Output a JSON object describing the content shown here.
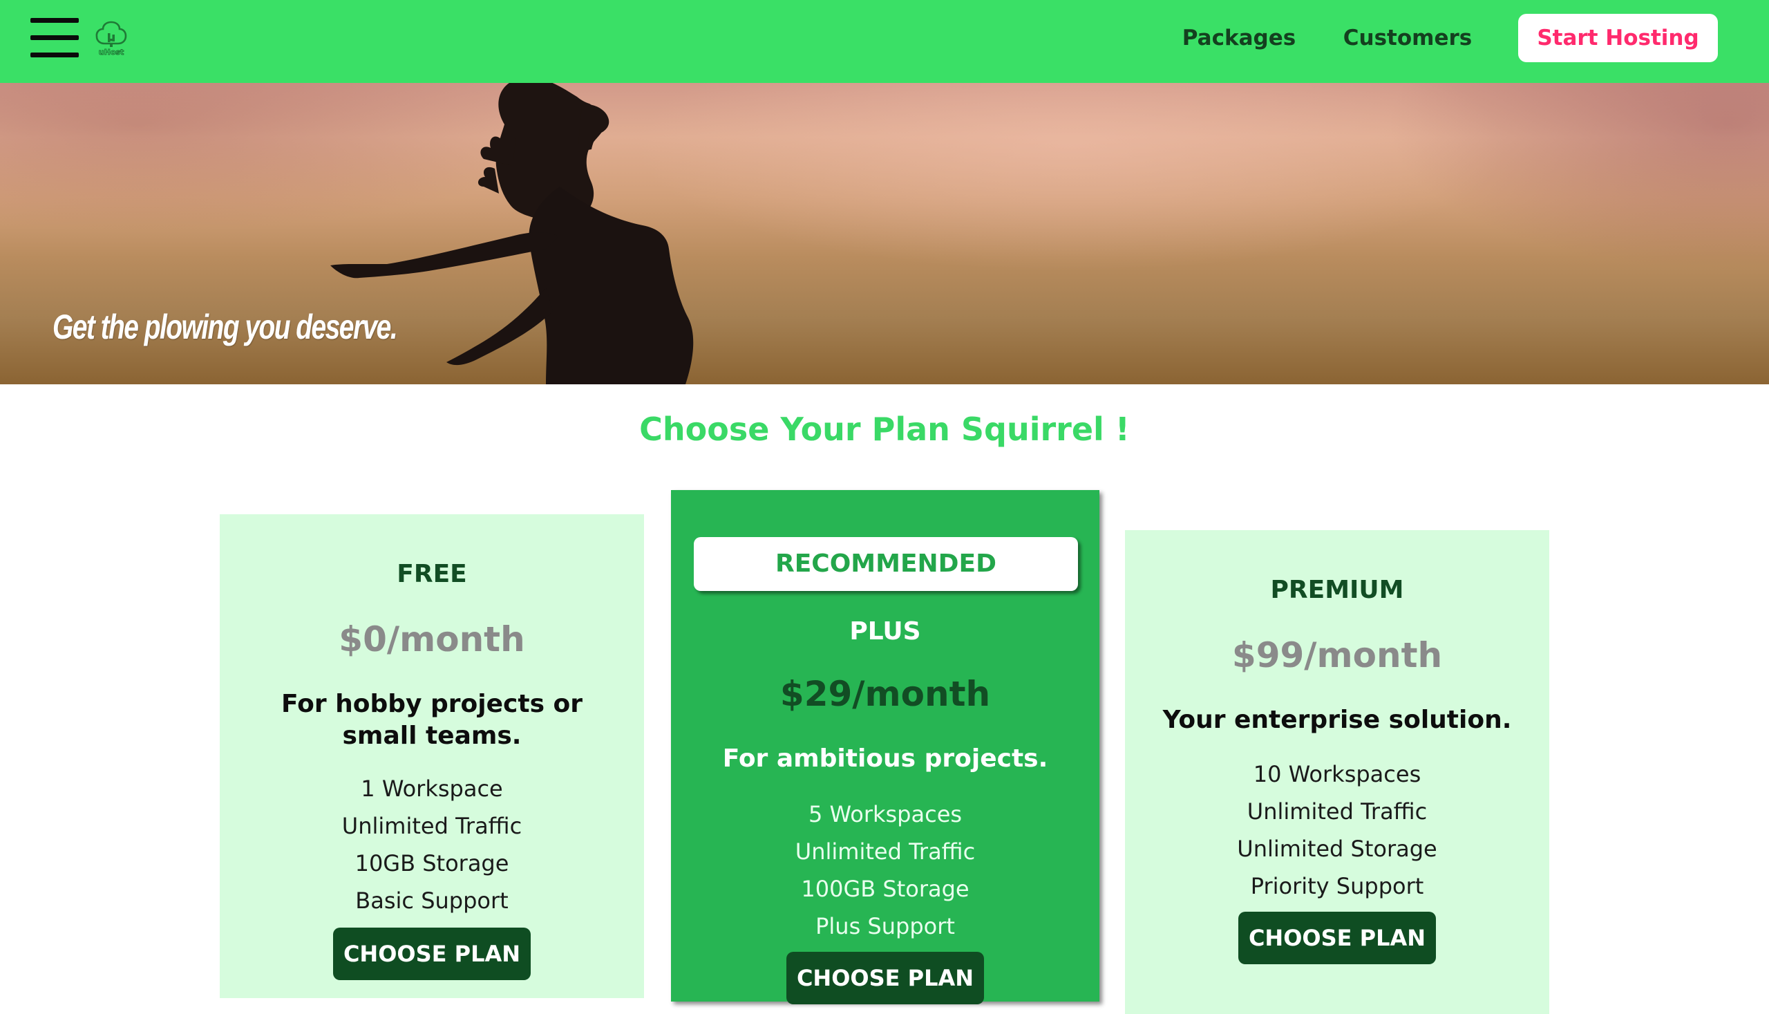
{
  "nav": {
    "packages": "Packages",
    "customers": "Customers",
    "start_hosting": "Start Hosting"
  },
  "logo": {
    "text": "uHost",
    "icon": "tree-logo-icon"
  },
  "hero": {
    "tagline": "Get the plowing you deserve."
  },
  "plans_heading": "Choose Your Plan Squirrel !",
  "plans": [
    {
      "name": "FREE",
      "price": "$0/month",
      "description": "For hobby projects or small teams.",
      "features": [
        "1 Workspace",
        "Unlimited Traffic",
        "10GB Storage",
        "Basic Support"
      ],
      "cta": "CHOOSE PLAN"
    },
    {
      "badge": "RECOMMENDED",
      "name": "PLUS",
      "price": "$29/month",
      "description": "For ambitious projects.",
      "features": [
        "5 Workspaces",
        "Unlimited Traffic",
        "100GB Storage",
        "Plus Support"
      ],
      "cta": "CHOOSE PLAN"
    },
    {
      "name": "PREMIUM",
      "price": "$99/month",
      "description": "Your enterprise solution.",
      "features": [
        "10 Workspaces",
        "Unlimited Traffic",
        "Unlimited Storage",
        "Priority Support"
      ],
      "cta": "CHOOSE PLAN"
    }
  ],
  "colors": {
    "nav_bg": "#3ae066",
    "accent_pink": "#ff2a6d",
    "heading_green": "#3ad966",
    "card_bg": "#d6fcdd",
    "recommended_bg": "#27b553",
    "button_dark": "#0f4d22"
  }
}
